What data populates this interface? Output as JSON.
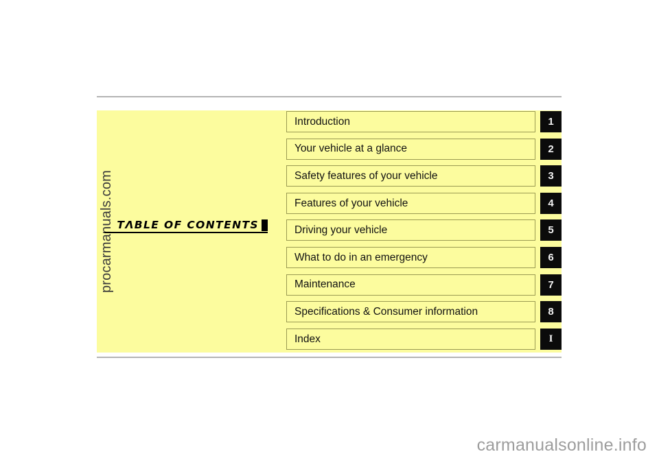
{
  "page": {
    "watermark_side": "procarmanuals.com",
    "watermark_bottom": "carmanualsonline.info",
    "background_color": "#ffffff",
    "panel_color": "#fcfc9e",
    "rule_color": "#b3b3b3",
    "tab_color": "#0b0b0b",
    "box_border_color": "#9a9a52"
  },
  "heading": {
    "title": "TΛBLE  OF  CONTENTS",
    "marker": ""
  },
  "contents": {
    "rows": [
      {
        "label": "Introduction",
        "tab": "1",
        "tab_style": "sans"
      },
      {
        "label": "Your vehicle at a glance",
        "tab": "2",
        "tab_style": "sans"
      },
      {
        "label": "Safety features of your vehicle",
        "tab": "3",
        "tab_style": "sans"
      },
      {
        "label": "Features of your vehicle",
        "tab": "4",
        "tab_style": "sans"
      },
      {
        "label": "Driving your vehicle",
        "tab": "5",
        "tab_style": "sans"
      },
      {
        "label": "What to do in an emergency",
        "tab": "6",
        "tab_style": "sans"
      },
      {
        "label": "Maintenance",
        "tab": "7",
        "tab_style": "sans"
      },
      {
        "label": "Specifications & Consumer information",
        "tab": "8",
        "tab_style": "sans"
      },
      {
        "label": "Index",
        "tab": "I",
        "tab_style": "serif"
      }
    ]
  }
}
